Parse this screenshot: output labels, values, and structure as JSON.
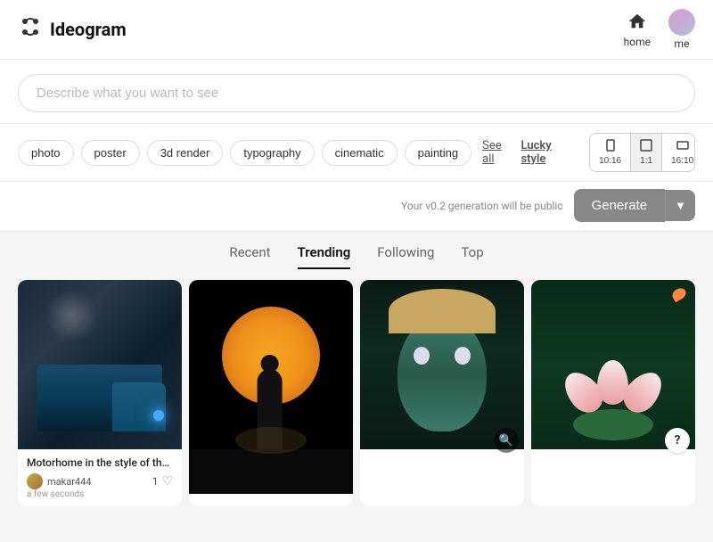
{
  "app": {
    "name": "Ideogram"
  },
  "header": {
    "home_label": "home",
    "me_label": "me"
  },
  "search": {
    "placeholder": "Describe what you want to see"
  },
  "tags": [
    {
      "label": "photo",
      "id": "photo"
    },
    {
      "label": "poster",
      "id": "poster"
    },
    {
      "label": "3d render",
      "id": "3d-render"
    },
    {
      "label": "typography",
      "id": "typography"
    },
    {
      "label": "cinematic",
      "id": "cinematic"
    },
    {
      "label": "painting",
      "id": "painting"
    }
  ],
  "links": {
    "see_all": "See all",
    "lucky_style": "Lucky style"
  },
  "ratios": [
    {
      "label": "10:16",
      "id": "10-16"
    },
    {
      "label": "1:1",
      "id": "1-1"
    },
    {
      "label": "16:10",
      "id": "16-10"
    }
  ],
  "generate": {
    "button_label": "Generate",
    "version_note": "Your v0.2 generation will be public"
  },
  "tabs": [
    {
      "label": "Recent",
      "id": "recent",
      "active": false
    },
    {
      "label": "Trending",
      "id": "trending",
      "active": true
    },
    {
      "label": "Following",
      "id": "following",
      "active": false
    },
    {
      "label": "Top",
      "id": "top",
      "active": false
    }
  ],
  "cards": [
    {
      "id": "card-1",
      "title": "Motorhome in the style of the...",
      "username": "makar444",
      "time": "a few seconds",
      "likes": "1",
      "type": "truck"
    },
    {
      "id": "card-2",
      "title": "",
      "type": "silhouette"
    },
    {
      "id": "card-3",
      "title": "",
      "type": "zombie"
    },
    {
      "id": "card-4",
      "title": "",
      "type": "lotus"
    }
  ]
}
